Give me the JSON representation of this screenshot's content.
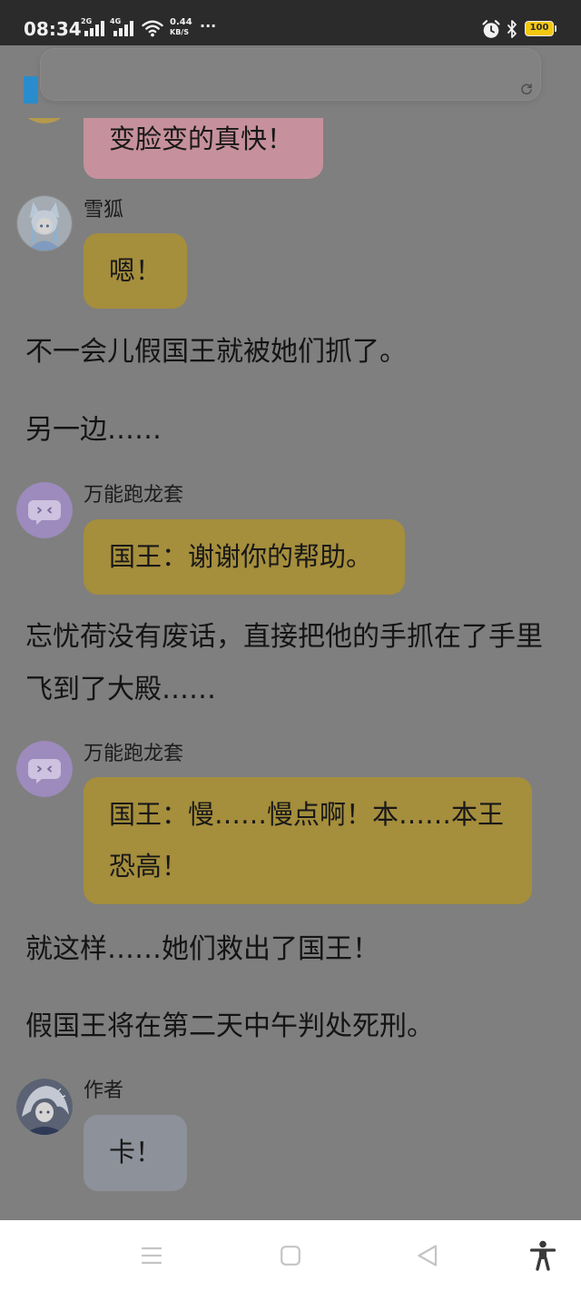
{
  "status_bar": {
    "time": "08:34",
    "sim1_network": "2G",
    "sim2_network": "4G",
    "net_speed": "0.44",
    "net_speed_unit": "KB/S",
    "more_indicator": "···",
    "battery_level": "100",
    "battery_color": "#f2c811",
    "icons": [
      "signal-icon",
      "signal-icon",
      "wifi-icon",
      "alarm-icon",
      "bluetooth-icon",
      "battery-icon"
    ]
  },
  "top_card": {
    "accent_color": "#2a8ccc",
    "icon": "refresh-icon"
  },
  "feed": [
    {
      "bubble_text": "变脸变的真快！",
      "bubble_color": "#c6919c",
      "avatar_icon": "avatar-icon"
    },
    {
      "speaker": "雪狐",
      "bubble_text": "嗯！",
      "bubble_color": "#a58e3c",
      "avatar_icon": "snow-fox-avatar-icon"
    },
    {
      "narration": "不一会儿假国王就被她们抓了。"
    },
    {
      "narration": "另一边……"
    },
    {
      "speaker": "万能跑龙套",
      "bubble_text": "国王：谢谢你的帮助。",
      "bubble_color": "#a58e3c",
      "avatar_icon": "chat-bubble-avatar-icon"
    },
    {
      "narration": "忘忧荷没有废话，直接把他的手抓在了手里飞到了大殿……"
    },
    {
      "speaker": "万能跑龙套",
      "bubble_text": "国王：慢……慢点啊！本……本王恐高！",
      "bubble_color": "#a58e3c",
      "avatar_icon": "chat-bubble-avatar-icon"
    },
    {
      "narration": "就这样……她们救出了国王！"
    },
    {
      "narration": "假国王将在第二天中午判处死刑。"
    },
    {
      "speaker": "作者",
      "bubble_text": "卡！",
      "bubble_color": "#8d9199",
      "avatar_icon": "author-avatar-icon"
    }
  ],
  "nav_bar": {
    "icons": [
      "menu-icon",
      "home-icon",
      "back-icon",
      "accessibility-icon"
    ]
  }
}
